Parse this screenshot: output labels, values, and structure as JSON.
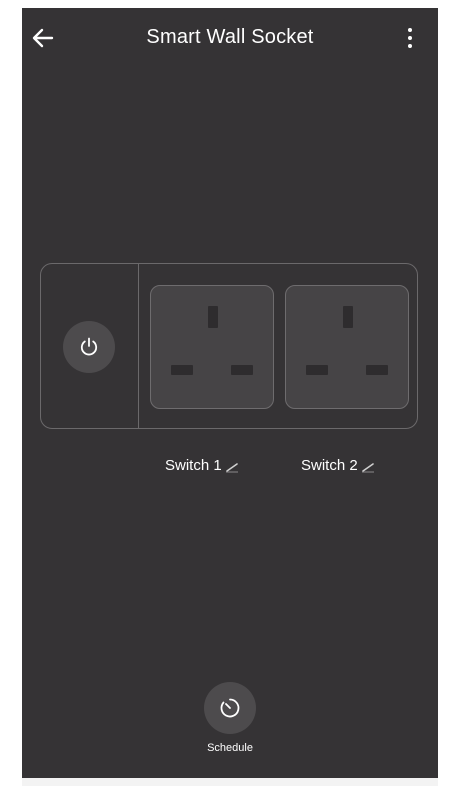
{
  "header": {
    "title": "Smart Wall Socket",
    "back_icon": "arrow-left-icon",
    "menu_icon": "more-vertical-icon"
  },
  "socket": {
    "master_icon": "power-icon",
    "outlets": [
      {
        "label": "Switch 1",
        "edit_icon": "pencil-icon"
      },
      {
        "label": "Switch 2",
        "edit_icon": "pencil-icon"
      }
    ]
  },
  "schedule": {
    "label": "Schedule",
    "icon": "timer-icon"
  },
  "colors": {
    "background": "#353335",
    "panel_border": "#6b696b",
    "button_bg": "#4d4b4d",
    "text": "#ffffff"
  }
}
